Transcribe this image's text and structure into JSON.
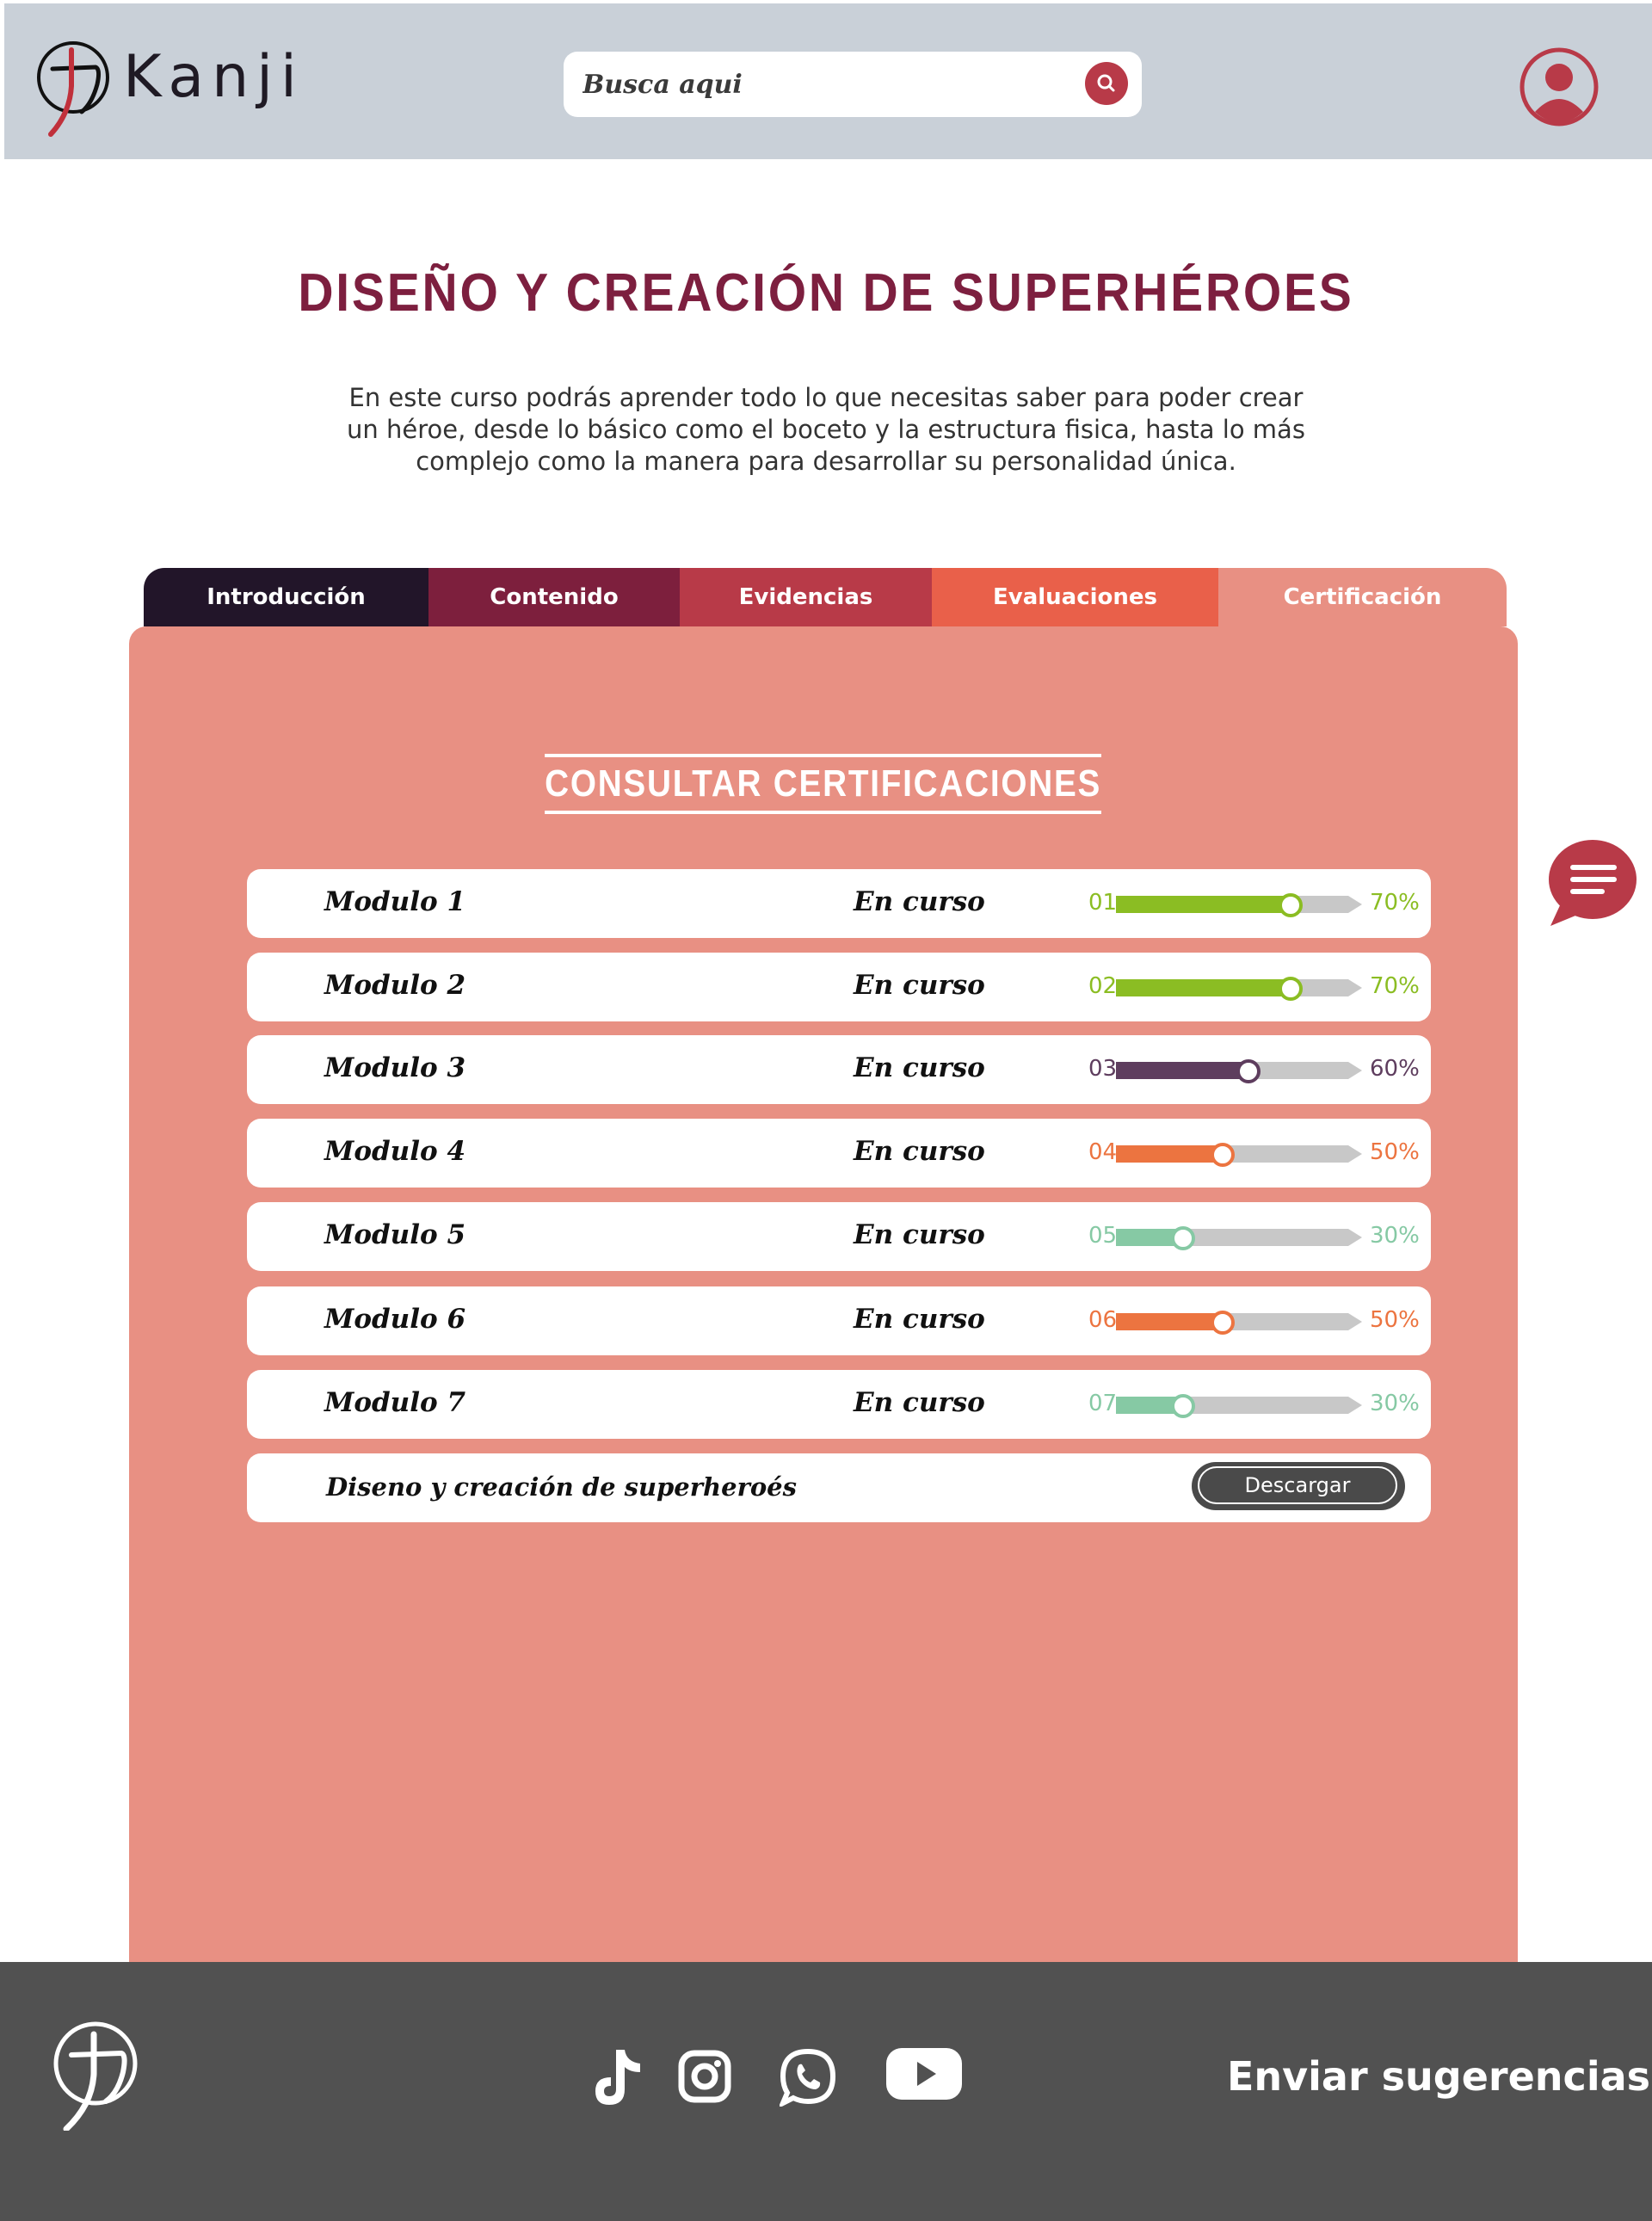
{
  "header": {
    "brand": "Kanji",
    "search_placeholder": "Busca aqui"
  },
  "course": {
    "title": "DISEÑO Y CREACIÓN DE SUPERHÉROES",
    "description": "En este curso podrás aprender todo lo que necesitas saber para poder crear un héroe, desde lo básico como el boceto y la estructura fisica, hasta lo más complejo como la manera para desarrollar su personalidad única."
  },
  "tabs": [
    {
      "label": "Introducción",
      "color": "#221529"
    },
    {
      "label": "Contenido",
      "color": "#7d1f3d"
    },
    {
      "label": "Evidencias",
      "color": "#b83a48"
    },
    {
      "label": "Evaluaciones",
      "color": "#e9604a"
    },
    {
      "label": "Certificación",
      "color": "#e89083",
      "active": true
    }
  ],
  "panel": {
    "title": "CONSULTAR CERTIFICACIONES",
    "background": "#e89083",
    "modules": [
      {
        "name": "Modulo 1",
        "status": "En curso",
        "num": "01",
        "percent": "70%",
        "progress": 0.75,
        "color": "#8bbd23"
      },
      {
        "name": "Modulo 2",
        "status": "En curso",
        "num": "02",
        "percent": "70%",
        "progress": 0.75,
        "color": "#8bbd23"
      },
      {
        "name": "Modulo 3",
        "status": "En curso",
        "num": "03",
        "percent": "60%",
        "progress": 0.57,
        "color": "#5e3d5e"
      },
      {
        "name": "Modulo 4",
        "status": "En curso",
        "num": "04",
        "percent": "50%",
        "progress": 0.46,
        "color": "#ec7440"
      },
      {
        "name": "Modulo 5",
        "status": "En curso",
        "num": "05",
        "percent": "30%",
        "progress": 0.29,
        "color": "#86c9a4"
      },
      {
        "name": "Modulo 6",
        "status": "En curso",
        "num": "06",
        "percent": "50%",
        "progress": 0.46,
        "color": "#ec7440"
      },
      {
        "name": "Modulo 7",
        "status": "En curso",
        "num": "07",
        "percent": "30%",
        "progress": 0.29,
        "color": "#86c9a4"
      }
    ],
    "certificate": {
      "name": "Diseno y creación de superheroés",
      "button_label": "Descargar"
    }
  },
  "footer": {
    "suggest_label": "Enviar sugerencias",
    "social": [
      "tiktok-icon",
      "instagram-icon",
      "whatsapp-icon",
      "youtube-icon"
    ]
  },
  "colors": {
    "accent": "#b83a48",
    "title": "#7d1f3f",
    "footer": "#515151",
    "header": "#c9d0d8"
  }
}
